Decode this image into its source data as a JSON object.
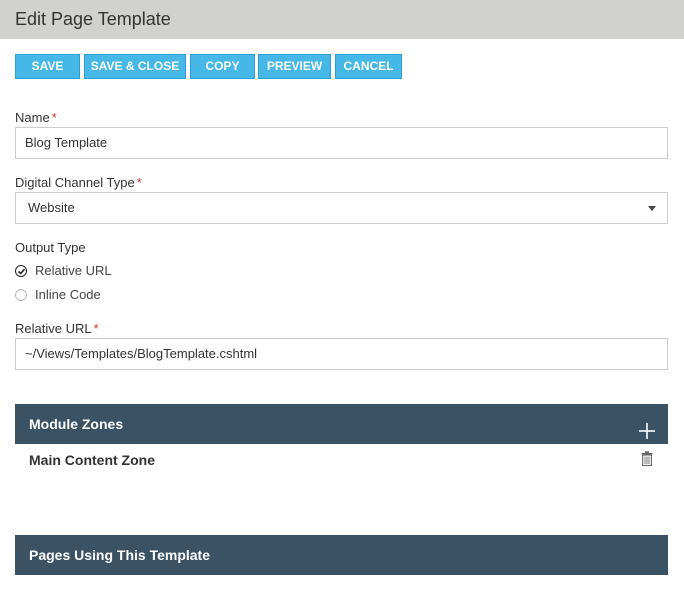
{
  "header": {
    "title": "Edit Page Template"
  },
  "toolbar": {
    "save_label": "SAVE",
    "save_close_label": "SAVE & CLOSE",
    "copy_label": "COPY",
    "preview_label": "PREVIEW",
    "cancel_label": "CANCEL"
  },
  "form": {
    "name": {
      "label": "Name",
      "required_mark": "*",
      "value": "Blog Template"
    },
    "channel_type": {
      "label": "Digital Channel Type",
      "required_mark": "*",
      "value": "Website"
    },
    "output_type": {
      "label": "Output Type",
      "options": [
        {
          "label": "Relative URL",
          "checked": true
        },
        {
          "label": "Inline Code",
          "checked": false
        }
      ]
    },
    "relative_url": {
      "label": "Relative URL",
      "required_mark": "*",
      "value": "~/Views/Templates/BlogTemplate.cshtml"
    }
  },
  "module_zones": {
    "title": "Module Zones",
    "add_icon": "plus-icon",
    "items": [
      {
        "name": "Main Content Zone",
        "delete_icon": "trash-icon"
      }
    ]
  },
  "pages_using": {
    "title": "Pages Using This Template"
  },
  "colors": {
    "header_bg": "#d1d1cf",
    "button_bg": "#45b8e8",
    "panel_bg": "#3a5263",
    "required": "#c0392b"
  }
}
